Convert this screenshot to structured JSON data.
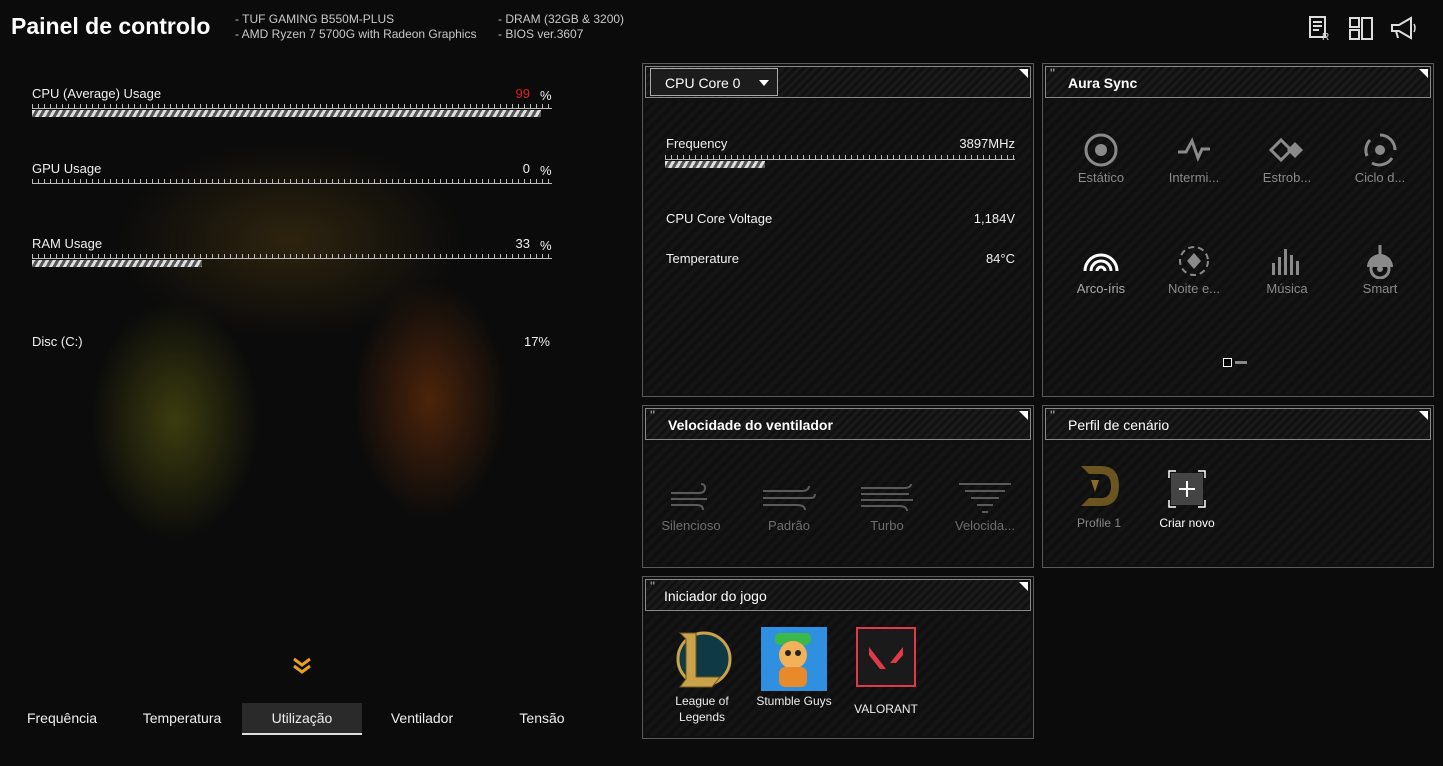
{
  "header": {
    "title": "Painel de controlo",
    "sysinfo_left": [
      "TUF GAMING B550M-PLUS",
      "AMD Ryzen 7 5700G with Radeon Graphics"
    ],
    "sysinfo_right": [
      "DRAM (32GB & 3200)",
      "BIOS ver.3607"
    ],
    "icons": [
      "report-icon",
      "layout-icon",
      "megaphone-icon"
    ]
  },
  "metrics": [
    {
      "label": "CPU (Average) Usage",
      "value": "99",
      "unit": "%",
      "percent": 99,
      "value_color": "#e02020"
    },
    {
      "label": "GPU Usage",
      "value": "0",
      "unit": "%",
      "percent": 0,
      "value_color": "#f0f0f0"
    },
    {
      "label": "RAM Usage",
      "value": "33",
      "unit": "%",
      "percent": 33,
      "value_color": "#f0f0f0"
    },
    {
      "label": "Disc (C:)",
      "value": "17%"
    }
  ],
  "tabs": [
    "Frequência",
    "Temperatura",
    "Utilização",
    "Ventilador",
    "Tensão"
  ],
  "active_tab": "Utilização",
  "cpu_panel": {
    "selector": "CPU Core 0",
    "frequency_label": "Frequency",
    "frequency_value": "3897MHz",
    "frequency_percent": 20,
    "voltage_label": "CPU Core Voltage",
    "voltage_value": "1,184V",
    "temp_label": "Temperature",
    "temp_value": "84°C"
  },
  "aura": {
    "title": "Aura Sync",
    "items": [
      {
        "label": "Estático",
        "icon": "static-icon"
      },
      {
        "label": "Intermi...",
        "icon": "pulse-icon"
      },
      {
        "label": "Estrob...",
        "icon": "strobe-icon"
      },
      {
        "label": "Ciclo d...",
        "icon": "color-cycle-icon"
      },
      {
        "label": "Arco-íris",
        "icon": "rainbow-icon"
      },
      {
        "label": "Noite e...",
        "icon": "starry-night-icon"
      },
      {
        "label": "Música",
        "icon": "music-icon"
      },
      {
        "label": "Smart",
        "icon": "smart-icon"
      }
    ]
  },
  "fan": {
    "title": "Velocidade do ventilador",
    "items": [
      "Silencioso",
      "Padrão",
      "Turbo",
      "Velocida..."
    ]
  },
  "scenario": {
    "title": "Perfil de cenário",
    "profile_label": "Profile 1",
    "create_label": "Criar novo"
  },
  "games": {
    "title": "Iniciador do jogo",
    "items": [
      "League of Legends",
      "Stumble Guys",
      "VALORANT"
    ]
  }
}
